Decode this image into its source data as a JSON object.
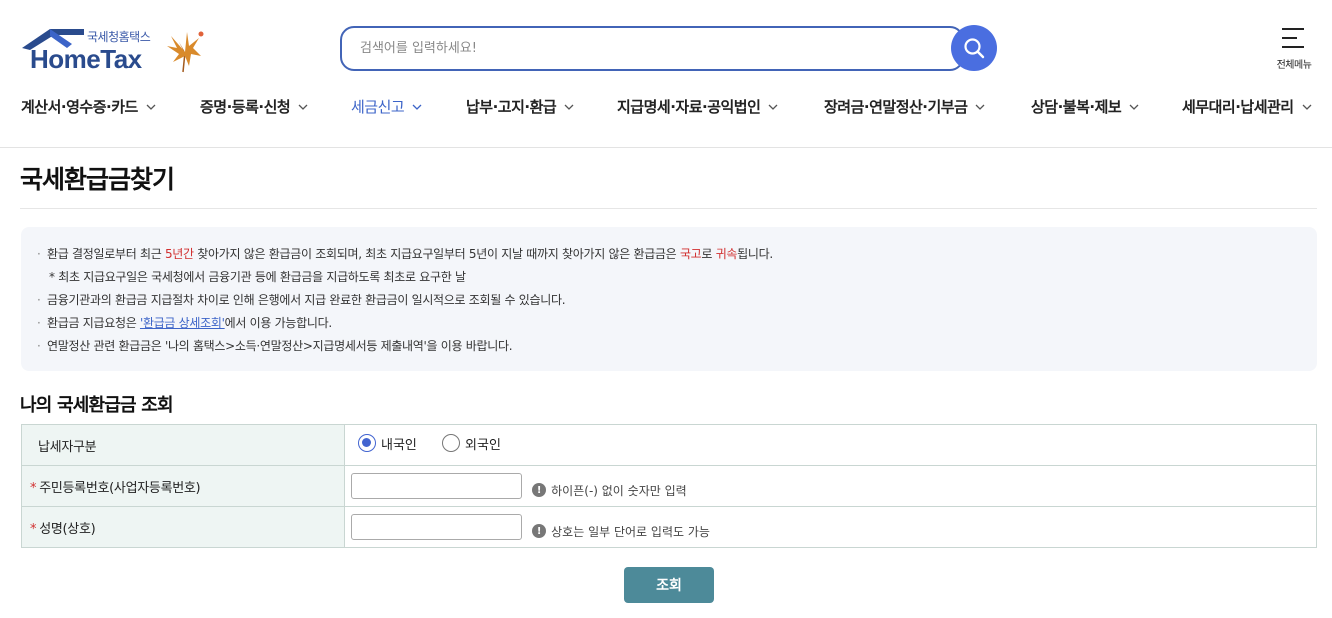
{
  "header": {
    "logo_sub": "국세청홈택스",
    "logo_main": "HomeTax",
    "search_placeholder": "검색어를 입력하세요!",
    "all_menu_label": "전체메뉴"
  },
  "gnb": [
    {
      "label": "계산서·영수증·카드",
      "active": false
    },
    {
      "label": "증명·등록·신청",
      "active": false
    },
    {
      "label": "세금신고",
      "active": true
    },
    {
      "label": "납부·고지·환급",
      "active": false
    },
    {
      "label": "지급명세·자료·공익법인",
      "active": false
    },
    {
      "label": "장려금·연말정산·기부금",
      "active": false
    },
    {
      "label": "상담·불복·제보",
      "active": false
    },
    {
      "label": "세무대리·납세관리",
      "active": false
    }
  ],
  "page_title": "국세환급금찾기",
  "notice": {
    "l1_a": "환급 결정일로부터 최근 ",
    "l1_red1": "5년간",
    "l1_b": " 찾아가지 않은 환급금이 조회되며, 최초 지급요구일부터 5년이 지날 때까지 찾아가지 않은 환급금은 ",
    "l1_red2": "국고",
    "l1_c": "로 ",
    "l1_red3": "귀속",
    "l1_d": "됩니다.",
    "l2": "* 최초 지급요구일은 국세청에서 금융기관 등에 환급금을 지급하도록 최초로 요구한 날",
    "l3": "금융기관과의 환급금 지급절차 차이로 인해 은행에서 지급 완료한 환급금이 일시적으로 조회될 수 있습니다.",
    "l4_a": "환급금 지급요청은 ",
    "l4_link": "'환급금 상세조회'",
    "l4_b": "에서 이용 가능합니다.",
    "l5": "연말정산 관련 환급금은 '나의 홈택스>소득·연말정산>지급명세서등 제출내역'을 이용 바랍니다."
  },
  "section_title": "나의 국세환급금 조회",
  "form": {
    "taxpayer_type_label": "납세자구분",
    "radio_domestic": "내국인",
    "radio_foreign": "외국인",
    "selected": "내국인",
    "id_label": "주민등록번호(사업자등록번호)",
    "id_value": "",
    "id_hint": "하이픈(-) 없이 숫자만 입력",
    "name_label": "성명(상호)",
    "name_value": "",
    "name_hint": "상호는 일부 단어로 입력도 가능",
    "required_mark": "*"
  },
  "submit_label": "조회",
  "colors": {
    "brand": "#2a4b8d",
    "accent": "#4a6ee0",
    "active_menu": "#3c64c8",
    "button": "#4d8a99",
    "emphasis": "#d12f2f"
  }
}
